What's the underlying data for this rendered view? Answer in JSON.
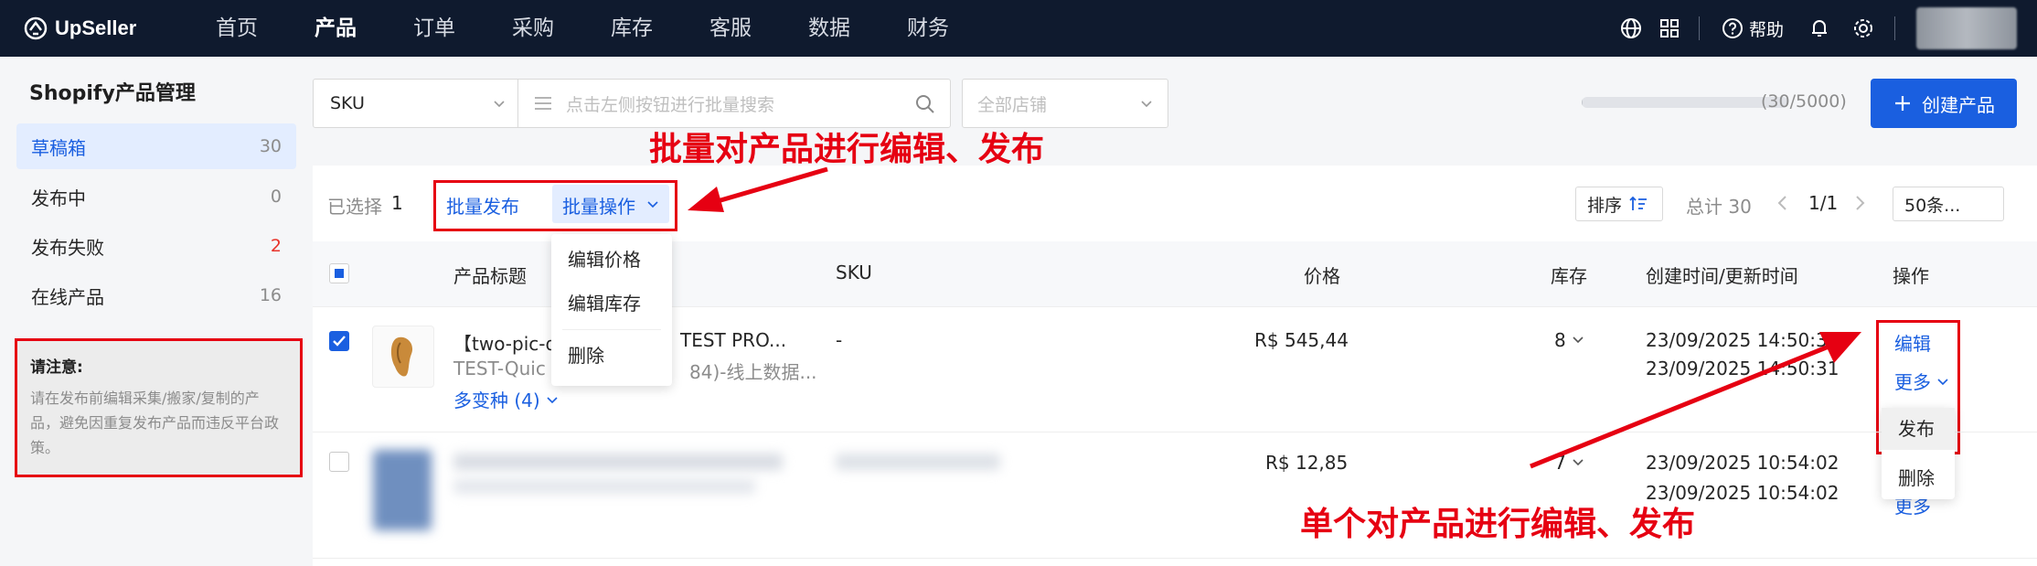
{
  "app": {
    "brand": "UpSeller"
  },
  "nav": {
    "items": [
      "首页",
      "产品",
      "订单",
      "采购",
      "库存",
      "客服",
      "数据",
      "财务"
    ],
    "active_index": 1
  },
  "topbar": {
    "help_label": "帮助"
  },
  "sidebar": {
    "title": "Shopify产品管理",
    "items": [
      {
        "label": "草稿箱",
        "count": "30"
      },
      {
        "label": "发布中",
        "count": "0"
      },
      {
        "label": "发布失败",
        "count": "2"
      },
      {
        "label": "在线产品",
        "count": "16"
      }
    ],
    "notice_title": "请注意:",
    "notice_body": "请在发布前编辑采集/搬家/复制的产品，避免因重复发布产品而违反平台政策。"
  },
  "search": {
    "field_select": "SKU",
    "placeholder": "点击左侧按钮进行批量搜索",
    "store_placeholder": "全部店铺"
  },
  "quota": {
    "label": "(30/5000)",
    "fraction": 0.006
  },
  "create_button": "创建产品",
  "toolbar": {
    "selected_label": "已选择",
    "selected_count": "1",
    "bulk_publish": "批量发布",
    "bulk_ops": "批量操作",
    "bulk_menu": [
      "编辑价格",
      "编辑库存",
      "删除"
    ],
    "sort_label": "排序",
    "total_label": "总计 30",
    "page": "1/1",
    "page_size": "50条..."
  },
  "annotations": {
    "bulk": "批量对产品进行编辑、发布",
    "single": "单个对产品进行编辑、发布"
  },
  "table": {
    "headers": {
      "title": "产品标题",
      "sku": "SKU",
      "price": "价格",
      "stock": "库存",
      "time": "创建时间/更新时间",
      "action": "操作"
    },
    "rows": [
      {
        "title_a": "【two-pic-d",
        "title_b": "TEST PRO...",
        "subtitle_a": "TEST-Quic",
        "subtitle_b": "84)-线上数据...",
        "variants": "多变种 (4)",
        "sku": "-",
        "price": "R$ 545,44",
        "stock": "8",
        "created": "23/09/2025 14:50:31",
        "updated": "23/09/2025 14:50:31",
        "edit": "编辑",
        "more": "更多",
        "more_menu": [
          "发布",
          "删除"
        ]
      },
      {
        "price": "R$ 12,85",
        "stock": "7",
        "created": "23/09/2025 10:54:02",
        "updated": "23/09/2025 10:54:02",
        "more": "更多"
      }
    ]
  },
  "colors": {
    "primary": "#1a5fe0",
    "annotation": "#e60012",
    "topbar": "#0f1a2e"
  }
}
